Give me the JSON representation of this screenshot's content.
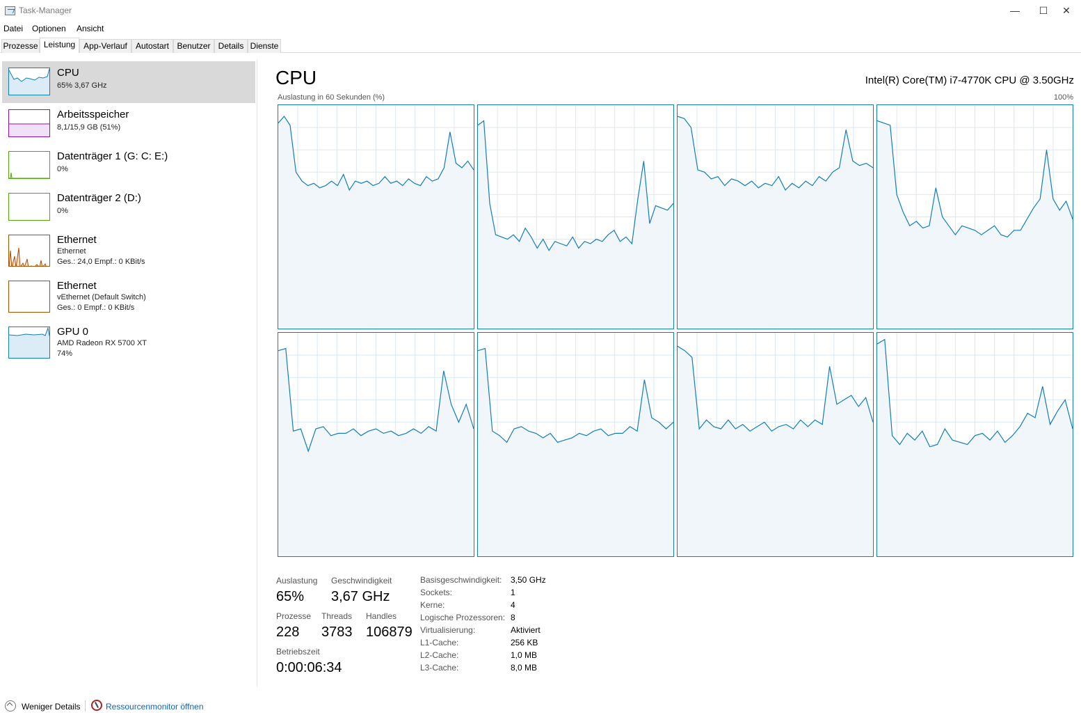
{
  "window": {
    "title": "Task-Manager"
  },
  "menu": [
    "Datei",
    "Optionen",
    "Ansicht"
  ],
  "tabs": [
    "Prozesse",
    "Leistung",
    "App-Verlauf",
    "Autostart",
    "Benutzer",
    "Details",
    "Dienste"
  ],
  "sidebar": [
    {
      "title": "CPU",
      "line1": "65% 3,67 GHz",
      "line2": "",
      "color": "#117dbb"
    },
    {
      "title": "Arbeitsspeicher",
      "line1": "8,1/15,9 GB (51%)",
      "line2": "",
      "color": "#8b12ae"
    },
    {
      "title": "Datenträger 1 (G: C: E:)",
      "line1": "0%",
      "line2": "",
      "color": "#4da60c"
    },
    {
      "title": "Datenträger 2 (D:)",
      "line1": "0%",
      "line2": "",
      "color": "#4da60c"
    },
    {
      "title": "Ethernet",
      "line1": "Ethernet",
      "line2": "Ges.: 24,0 Empf.: 0 KBit/s",
      "color": "#a74f01"
    },
    {
      "title": "Ethernet",
      "line1": "vEthernet (Default Switch)",
      "line2": "Ges.: 0 Empf.: 0 KBit/s",
      "color": "#a74f01"
    },
    {
      "title": "GPU 0",
      "line1": "AMD Radeon RX 5700 XT",
      "line2": "74%",
      "color": "#117dbb"
    }
  ],
  "main": {
    "title": "CPU",
    "model": "Intel(R) Core(TM) i7-4770K CPU @ 3.50GHz",
    "graph_caption": "Auslastung in 60 Sekunden (%)",
    "graph_max": "100%"
  },
  "chart_data": {
    "type": "line",
    "title": "Auslastung in 60 Sekunden (%)",
    "ylim": [
      0,
      100
    ],
    "series": [
      {
        "values": [
          92,
          95,
          91,
          70,
          66,
          64,
          65,
          63,
          64,
          66,
          64,
          69,
          62,
          66,
          65,
          66,
          64,
          65,
          68,
          65,
          66,
          64,
          67,
          65,
          64,
          68,
          66,
          67,
          72,
          88,
          74,
          72,
          75,
          71
        ]
      },
      {
        "values": [
          91,
          93,
          56,
          42,
          41,
          40,
          42,
          39,
          45,
          41,
          36,
          40,
          35,
          39,
          38,
          37,
          41,
          36,
          39,
          38,
          40,
          39,
          42,
          44,
          39,
          41,
          38,
          58,
          75,
          47,
          55,
          54,
          53,
          56
        ]
      },
      {
        "values": [
          95,
          94,
          90,
          71,
          70,
          67,
          68,
          64,
          67,
          66,
          64,
          66,
          63,
          65,
          64,
          68,
          62,
          65,
          63,
          66,
          64,
          68,
          66,
          70,
          72,
          89,
          75,
          73,
          74,
          72
        ]
      },
      {
        "values": [
          93,
          92,
          91,
          60,
          52,
          46,
          48,
          45,
          46,
          63,
          50,
          46,
          42,
          46,
          45,
          44,
          42,
          44,
          46,
          42,
          41,
          44,
          44,
          49,
          54,
          58,
          80,
          58,
          53,
          57,
          49
        ]
      },
      {
        "values": [
          92,
          93,
          56,
          57,
          47,
          57,
          58,
          54,
          55,
          55,
          57,
          54,
          56,
          57,
          55,
          56,
          54,
          55,
          57,
          55,
          58,
          56,
          83,
          68,
          60,
          68,
          57
        ]
      },
      {
        "values": [
          92,
          93,
          56,
          54,
          51,
          57,
          58,
          56,
          55,
          53,
          55,
          51,
          52,
          53,
          55,
          54,
          56,
          57,
          54,
          55,
          55,
          58,
          56,
          79,
          62,
          60,
          57,
          60
        ]
      },
      {
        "values": [
          94,
          92,
          89,
          57,
          61,
          58,
          57,
          61,
          57,
          59,
          56,
          58,
          60,
          56,
          58,
          59,
          57,
          61,
          58,
          61,
          59,
          85,
          68,
          70,
          72,
          67,
          71,
          60
        ]
      },
      {
        "values": [
          95,
          97,
          54,
          50,
          55,
          52,
          56,
          49,
          50,
          57,
          52,
          51,
          50,
          54,
          55,
          52,
          56,
          51,
          54,
          58,
          64,
          62,
          76,
          59,
          65,
          70,
          57
        ]
      }
    ]
  },
  "stats": {
    "util_label": "Auslastung",
    "util_value": "65%",
    "speed_label": "Geschwindigkeit",
    "speed_value": "3,67 GHz",
    "proc_label": "Prozesse",
    "proc_value": "228",
    "threads_label": "Threads",
    "threads_value": "3783",
    "handles_label": "Handles",
    "handles_value": "106879",
    "uptime_label": "Betriebszeit",
    "uptime_value": "0:00:06:34"
  },
  "details": [
    {
      "label": "Basisgeschwindigkeit:",
      "value": "3,50 GHz"
    },
    {
      "label": "Sockets:",
      "value": "1"
    },
    {
      "label": "Kerne:",
      "value": "4"
    },
    {
      "label": "Logische Prozessoren:",
      "value": "8"
    },
    {
      "label": "Virtualisierung:",
      "value": "Aktiviert"
    },
    {
      "label": "L1-Cache:",
      "value": "256 KB"
    },
    {
      "label": "L2-Cache:",
      "value": "1,0 MB"
    },
    {
      "label": "L3-Cache:",
      "value": "8,0 MB"
    }
  ],
  "footer": {
    "less_details": "Weniger Details",
    "resource_monitor": "Ressourcenmonitor öffnen"
  }
}
